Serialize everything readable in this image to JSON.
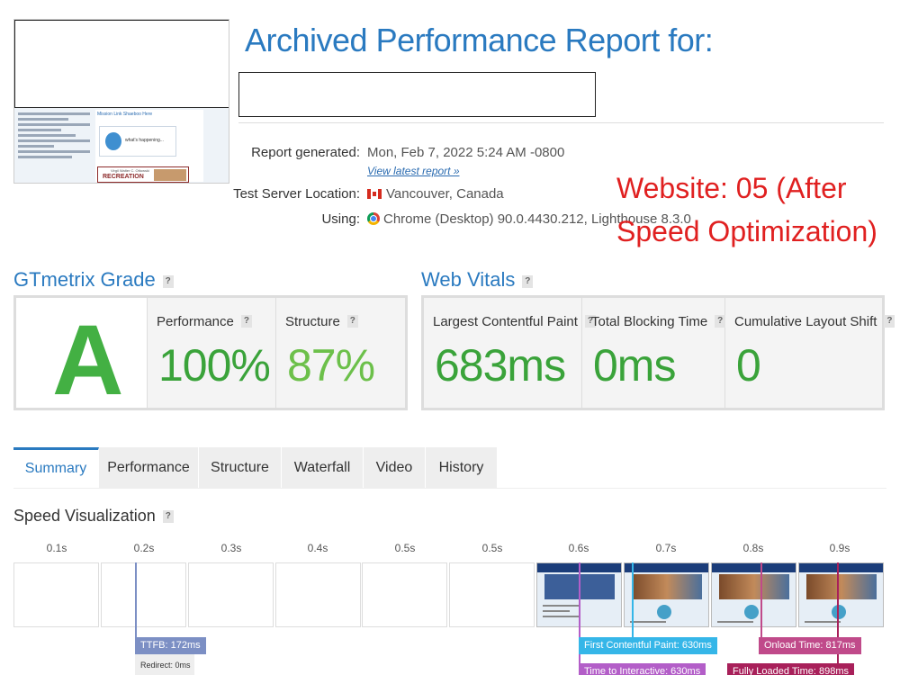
{
  "header": {
    "title": "Archived Performance Report for:",
    "annotation_line1": "Website: 05 (After",
    "annotation_line2": "Speed Optimization)"
  },
  "thumbnail": {
    "link_text": "Mission Link Shaeboo Here",
    "card_text": "what's happening...",
    "rec_small": "Virgil Walter C. Ottowski",
    "rec_text": "RECREATION"
  },
  "info": {
    "report_label": "Report generated:",
    "report_value": "Mon, Feb 7, 2022 5:24 AM -0800",
    "latest_link": "View latest report »",
    "location_label": "Test Server Location:",
    "location_value": "Vancouver, Canada",
    "using_label": "Using:",
    "using_value": "Chrome (Desktop) 90.0.4430.212, Lighthouse 8.3.0"
  },
  "grade": {
    "section_title": "GTmetrix Grade",
    "letter": "A",
    "performance_label": "Performance",
    "performance_value": "100%",
    "structure_label": "Structure",
    "structure_value": "87%"
  },
  "vitals": {
    "section_title": "Web Vitals",
    "lcp_label": "Largest Contentful Paint",
    "lcp_value": "683ms",
    "tbt_label": "Total Blocking Time",
    "tbt_value": "0ms",
    "cls_label": "Cumulative Layout Shift",
    "cls_value": "0"
  },
  "tabs": [
    "Summary",
    "Performance",
    "Structure",
    "Waterfall",
    "Video",
    "History"
  ],
  "speed_viz": {
    "title": "Speed Visualization",
    "ticks": [
      "0.1s",
      "0.2s",
      "0.3s",
      "0.4s",
      "0.5s",
      "0.5s",
      "0.6s",
      "0.7s",
      "0.8s",
      "0.9s"
    ],
    "ttfb": "TTFB: 172ms",
    "ttfb_redirect": "Redirect: 0ms",
    "fcp": "First Contentful Paint: 630ms",
    "tti": "Time to Interactive: 630ms",
    "onload": "Onload Time: 817ms",
    "fully_loaded": "Fully Loaded Time: 898ms"
  },
  "colors": {
    "accent": "#2a7ac0",
    "grade_green": "#43b043",
    "value_green": "#3aa33a",
    "annotation_red": "#e02020",
    "ttfb": "#7c8fc4",
    "fcp": "#35b6e8",
    "tti": "#b35ec8",
    "onload": "#c04a8a",
    "fully_loaded": "#a8205a"
  }
}
